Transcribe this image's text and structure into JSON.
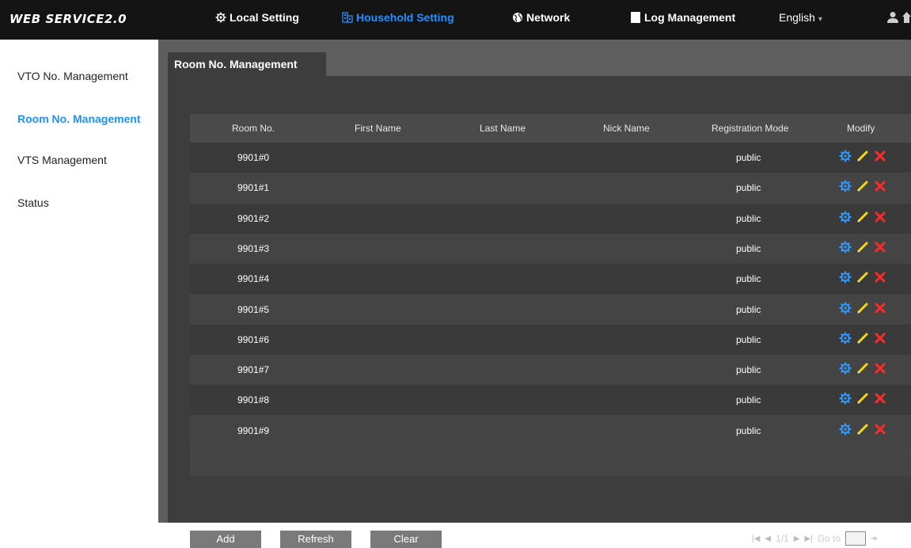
{
  "app": {
    "brand": "WEB SERVICE2.0"
  },
  "topnav": {
    "items": [
      {
        "label": "Local Setting",
        "icon": "gear-icon"
      },
      {
        "label": "Household Setting",
        "icon": "building-icon"
      },
      {
        "label": "Network",
        "icon": "globe-icon"
      },
      {
        "label": "Log Management",
        "icon": "log-icon"
      }
    ],
    "language": "English",
    "accent": "#1e90ff"
  },
  "sidebar": {
    "items": [
      {
        "label": "VTO No. Management"
      },
      {
        "label": "Room No. Management"
      },
      {
        "label": "VTS Management"
      },
      {
        "label": "Status"
      }
    ]
  },
  "panel": {
    "title": "Room No. Management"
  },
  "table": {
    "headers": [
      "Room No.",
      "First Name",
      "Last Name",
      "Nick Name",
      "Registration Mode",
      "Modify"
    ],
    "rows": [
      {
        "room": "9901#0",
        "first": "",
        "last": "",
        "nick": "",
        "mode": "public"
      },
      {
        "room": "9901#1",
        "first": "",
        "last": "",
        "nick": "",
        "mode": "public"
      },
      {
        "room": "9901#2",
        "first": "",
        "last": "",
        "nick": "",
        "mode": "public"
      },
      {
        "room": "9901#3",
        "first": "",
        "last": "",
        "nick": "",
        "mode": "public"
      },
      {
        "room": "9901#4",
        "first": "",
        "last": "",
        "nick": "",
        "mode": "public"
      },
      {
        "room": "9901#5",
        "first": "",
        "last": "",
        "nick": "",
        "mode": "public"
      },
      {
        "room": "9901#6",
        "first": "",
        "last": "",
        "nick": "",
        "mode": "public"
      },
      {
        "room": "9901#7",
        "first": "",
        "last": "",
        "nick": "",
        "mode": "public"
      },
      {
        "room": "9901#8",
        "first": "",
        "last": "",
        "nick": "",
        "mode": "public"
      },
      {
        "room": "9901#9",
        "first": "",
        "last": "",
        "nick": "",
        "mode": "public"
      }
    ]
  },
  "actions": {
    "add": "Add",
    "refresh": "Refresh",
    "clear": "Clear"
  },
  "pager": {
    "page": "1/1",
    "goto_label": "Go to",
    "goto_value": ""
  }
}
